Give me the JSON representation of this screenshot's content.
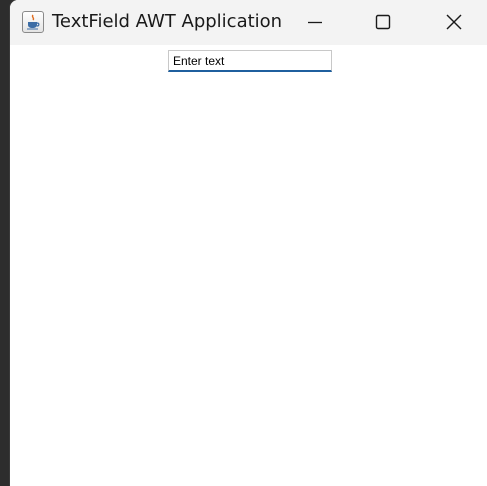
{
  "window": {
    "title": "TextField AWT Application",
    "icon": "java-coffee-icon",
    "controls": [
      "minimize-icon",
      "maximize-icon",
      "close-icon"
    ]
  },
  "textfield": {
    "value": "Enter text"
  },
  "colors": {
    "titlebar": "#f3f3f3",
    "client": "#ffffff",
    "field_underline": "#1f5f9e"
  }
}
